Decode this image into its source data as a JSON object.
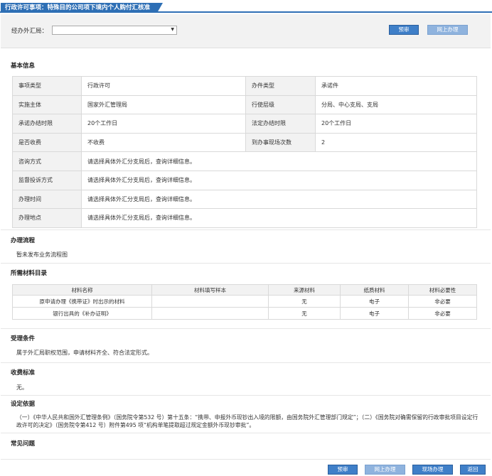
{
  "header": {
    "title": "行政许可事项：特殊目的公司项下境内个人购付汇核准"
  },
  "bureau_select": {
    "label": "经办外汇局：",
    "value": ""
  },
  "buttons": {
    "pre_apply": "预审",
    "online_apply": "网上办理",
    "onsite_apply": "现场办理",
    "back": "返回"
  },
  "basic_info": {
    "title": "基本信息",
    "rows": [
      {
        "l1": "事项类型",
        "v1": "行政许可",
        "l2": "办件类型",
        "v2": "承诺件"
      },
      {
        "l1": "实施主体",
        "v1": "国家外汇管理局",
        "l2": "行使层级",
        "v2": "分局、中心支局、支局"
      },
      {
        "l1": "承诺办结时限",
        "v1": "20个工作日",
        "l2": "法定办结时限",
        "v2": "20个工作日"
      },
      {
        "l1": "是否收费",
        "v1": "不收费",
        "l2": "到办事现场次数",
        "v2": "2"
      }
    ],
    "wide_rows": [
      {
        "l": "咨询方式",
        "v": "请选择具体外汇分支局后，查询详细信息。"
      },
      {
        "l": "监督投诉方式",
        "v": "请选择具体外汇分支局后，查询详细信息。"
      },
      {
        "l": "办理时间",
        "v": "请选择具体外汇分支局后，查询详细信息。"
      },
      {
        "l": "办理地点",
        "v": "请选择具体外汇分支局后，查询详细信息。"
      }
    ]
  },
  "process": {
    "title": "办理流程",
    "text": "暂未发布业务流程图"
  },
  "materials": {
    "title": "所需材料目录",
    "headers": [
      "材料名称",
      "材料填写样本",
      "来源材料",
      "纸质材料",
      "材料必要性"
    ],
    "rows": [
      [
        "原申请办理《携带证》时出示的材料",
        "",
        "无",
        "电子",
        "非必要"
      ],
      [
        "银行出具的《补办证明》",
        "",
        "无",
        "电子",
        "非必要"
      ]
    ]
  },
  "conditions": {
    "title": "受理条件",
    "text": "属于外汇局职权范围，申请材料齐全、符合法定形式。"
  },
  "fee_standard": {
    "title": "收费标准",
    "text": "无。"
  },
  "legal_basis": {
    "title": "设定依据",
    "text": "（一）《中华人民共和国外汇管理条例》（国务院令第532 号）第十五条：“携带、申报外币现钞出入境的限额，由国务院外汇管理部门规定”；（二）《国务院对确需保留的行政审批项目设定行政许可的决定》（国务院令第412 号）附件第495 项“机构单笔提取超过规定金额外币现钞审批”。"
  },
  "faq": {
    "title": "常见问题"
  }
}
